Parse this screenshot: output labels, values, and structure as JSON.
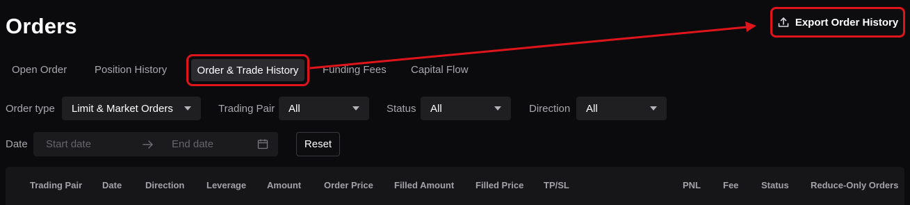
{
  "header": {
    "title": "Orders",
    "export_label": "Export Order History",
    "export_icon": "upload-icon"
  },
  "tabs": [
    {
      "label": "Open Order",
      "active": false
    },
    {
      "label": "Position History",
      "active": false
    },
    {
      "label": "Order & Trade History",
      "active": true
    },
    {
      "label": "Funding Fees",
      "active": false
    },
    {
      "label": "Capital Flow",
      "active": false
    }
  ],
  "filters": {
    "order_type": {
      "label": "Order type",
      "value": "Limit & Market Orders"
    },
    "trading_pair": {
      "label": "Trading Pair",
      "value": "All"
    },
    "status": {
      "label": "Status",
      "value": "All"
    },
    "direction": {
      "label": "Direction",
      "value": "All"
    }
  },
  "date_filter": {
    "label": "Date",
    "start_placeholder": "Start date",
    "end_placeholder": "End date",
    "reset_label": "Reset"
  },
  "table": {
    "columns": [
      "Trading Pair",
      "Date",
      "Direction",
      "Leverage",
      "Amount",
      "Order Price",
      "Filled Amount",
      "Filled Price",
      "TP/SL",
      "PNL",
      "Fee",
      "Status",
      "Reduce-Only Orders"
    ]
  },
  "colors": {
    "background": "#0b0b0d",
    "highlight_annotation": "#e0151b",
    "active_tab_bg": "#2b2b2f",
    "select_bg": "#1f1f22"
  }
}
